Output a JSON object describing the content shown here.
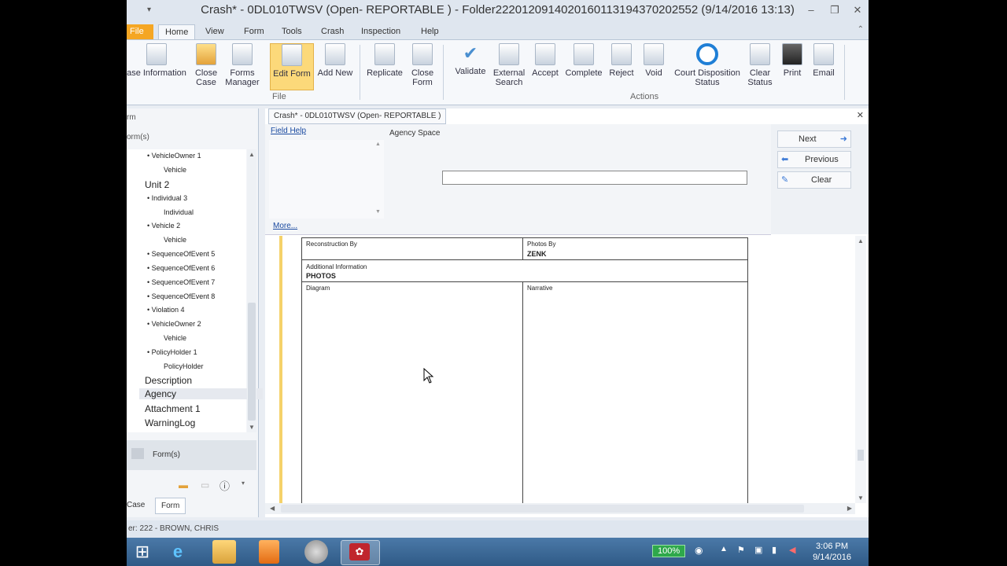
{
  "window": {
    "title": "Crash* - 0DL010TWSV (Open- REPORTABLE ) - Folder22201209140201601131943702​02552 (9/14/2016 13:13)",
    "controls": [
      "‒",
      "❐",
      "✕"
    ]
  },
  "menu_tabs": [
    "File",
    "Home",
    "View",
    "Form",
    "Tools",
    "Crash",
    "Inspection",
    "Help"
  ],
  "ribbon": {
    "file_buttons": [
      "ase Information",
      "Close Case",
      "Forms Manager",
      "Edit Form",
      "Add New",
      "Replicate",
      "Close Form"
    ],
    "file_group": "File",
    "action_buttons": [
      "Validate",
      "External Search",
      "Accept",
      "Complete",
      "Reject",
      "Void",
      "Court Disposition Status",
      "Clear Status",
      "Print",
      "Email"
    ],
    "actions_group": "Actions"
  },
  "left_pane": {
    "header1": "rm",
    "header2": "orm(s)",
    "tree": [
      {
        "label": "• VehicleOwner 1",
        "level": 2
      },
      {
        "label": "Vehicle",
        "level": 3
      },
      {
        "label": "Unit 2",
        "level": 1
      },
      {
        "label": "• Individual 3",
        "level": 2
      },
      {
        "label": "Individual",
        "level": 3
      },
      {
        "label": "• Vehicle 2",
        "level": 2
      },
      {
        "label": "Vehicle",
        "level": 3
      },
      {
        "label": "• SequenceOfEvent 5",
        "level": 2
      },
      {
        "label": "• SequenceOfEvent 6",
        "level": 2
      },
      {
        "label": "• SequenceOfEvent 7",
        "level": 2
      },
      {
        "label": "• SequenceOfEvent 8",
        "level": 2
      },
      {
        "label": "• Violation 4",
        "level": 2
      },
      {
        "label": "• VehicleOwner 2",
        "level": 2
      },
      {
        "label": "Vehicle",
        "level": 3
      },
      {
        "label": "• PolicyHolder 1",
        "level": 2
      },
      {
        "label": "PolicyHolder",
        "level": 3
      },
      {
        "label": "Description",
        "level": 1
      },
      {
        "label": "Agency",
        "level": 1,
        "selected": true
      },
      {
        "label": "Attachment 1",
        "level": 1
      },
      {
        "label": "WarningLog",
        "level": 1
      }
    ],
    "forms_button": "Form(s)",
    "bottom_tabs": [
      "Case",
      "Form"
    ]
  },
  "main": {
    "doc_tab": "Crash* - 0DL010TWSV (Open- REPORTABLE )",
    "close": "✕",
    "field_help": "Field Help",
    "more": "More...",
    "field_label": "Agency Space",
    "field_value": "",
    "nav": {
      "next": "Next",
      "previous": "Previous",
      "clear": "Clear"
    },
    "form": {
      "reconstruction_by_label": "Reconstruction By",
      "photos_by_label": "Photos By",
      "photos_by_value": "ZENK",
      "additional_info_label": "Additional Information",
      "additional_info_value": "PHOTOS",
      "diagram_label": "Diagram",
      "narrative_label": "Narrative"
    }
  },
  "status_bar": "er: 222 - BROWN, CHRIS",
  "taskbar": {
    "battery": "100%",
    "time": "3:06 PM",
    "date": "9/14/2016"
  }
}
